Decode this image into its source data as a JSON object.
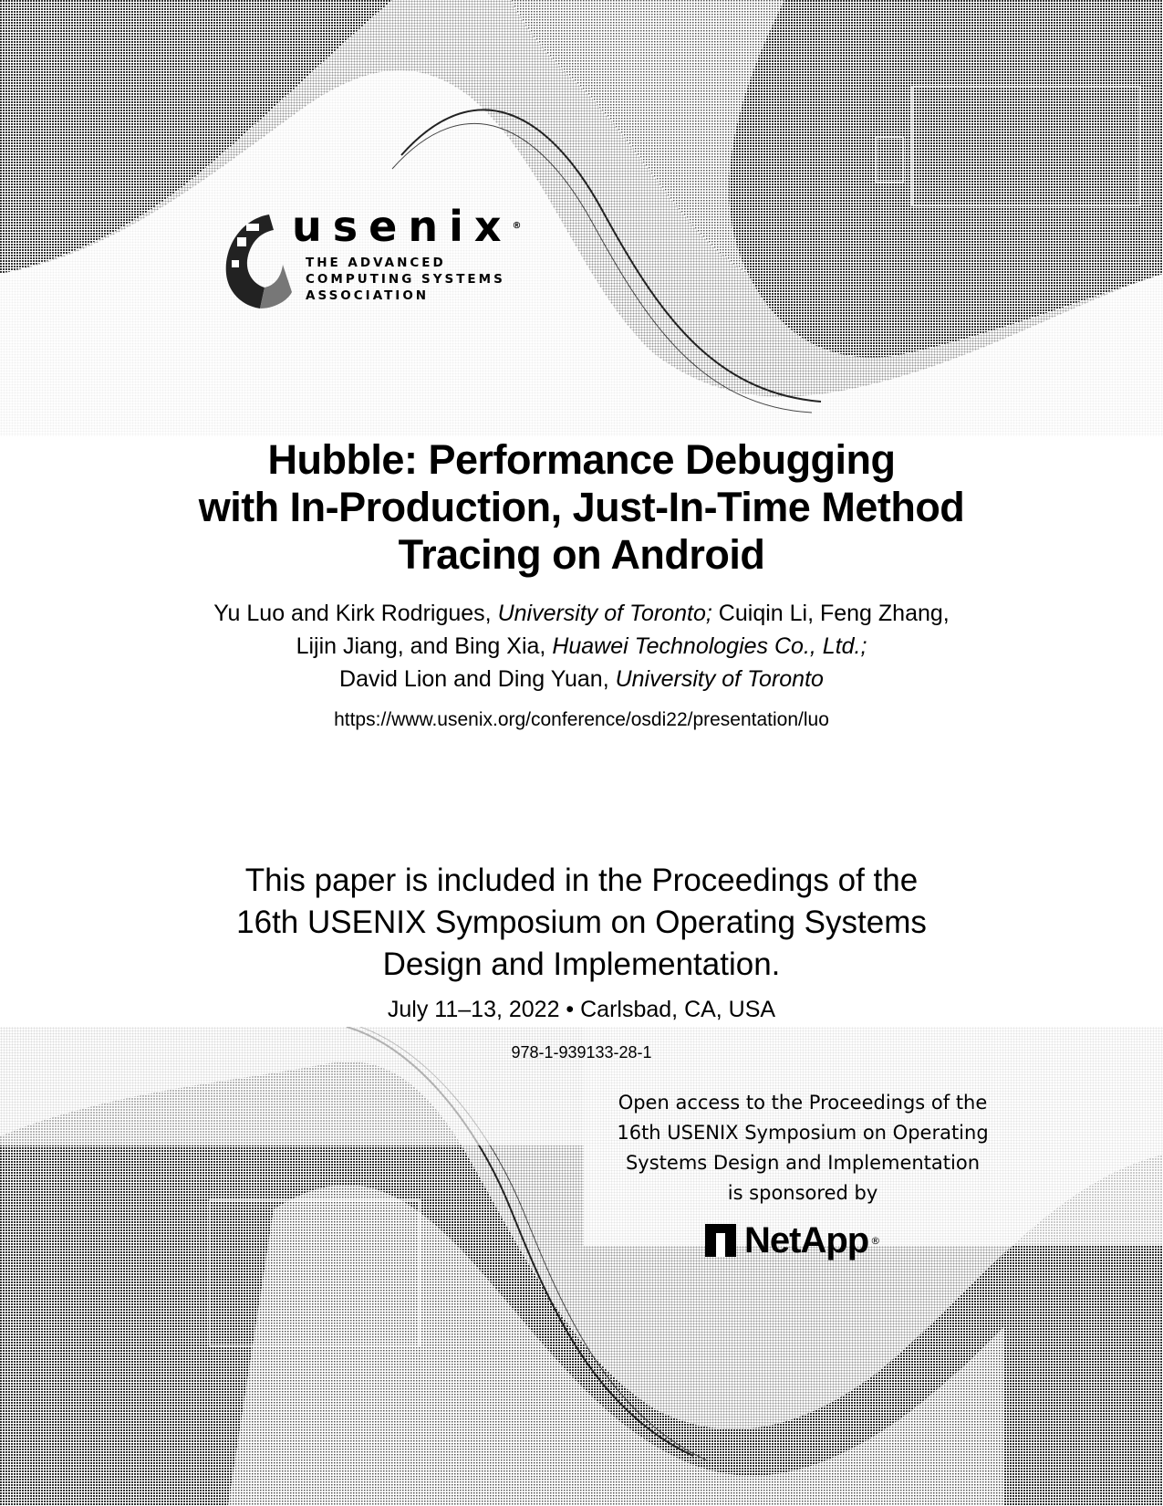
{
  "header": {
    "organization_logo": {
      "wordmark": "usenix",
      "registered_mark": "®",
      "tagline_lines": [
        "THE ADVANCED",
        "COMPUTING SYSTEMS",
        "ASSOCIATION"
      ]
    }
  },
  "paper": {
    "title_lines": [
      "Hubble: Performance Debugging",
      "with In-Production, Just-In-Time Method",
      "Tracing on Android"
    ],
    "authors": [
      {
        "names": "Yu Luo and Kirk Rodrigues, ",
        "affiliation": "University of Toronto;",
        "tail": " Cuiqin Li, Feng Zhang,"
      },
      {
        "names": "Lijin Jiang, and Bing Xia, ",
        "affiliation": "Huawei Technologies Co., Ltd.;",
        "tail": ""
      },
      {
        "names": "David Lion and Ding Yuan, ",
        "affiliation": "University of Toronto",
        "tail": ""
      }
    ],
    "url": "https://www.usenix.org/conference/osdi22/presentation/luo"
  },
  "proceedings": {
    "lines": [
      "This paper is included in the Proceedings of the",
      "16th USENIX Symposium on Operating Systems",
      "Design and Implementation."
    ],
    "dates_location": "July 11–13, 2022 • Carlsbad, CA, USA",
    "isbn": "978-1-939133-28-1"
  },
  "sponsor": {
    "lines": [
      "Open access to the Proceedings of the",
      "16th USENIX Symposium on Operating",
      "Systems Design and Implementation",
      "is sponsored by"
    ],
    "sponsor_name": "NetApp",
    "registered_mark": "®"
  }
}
